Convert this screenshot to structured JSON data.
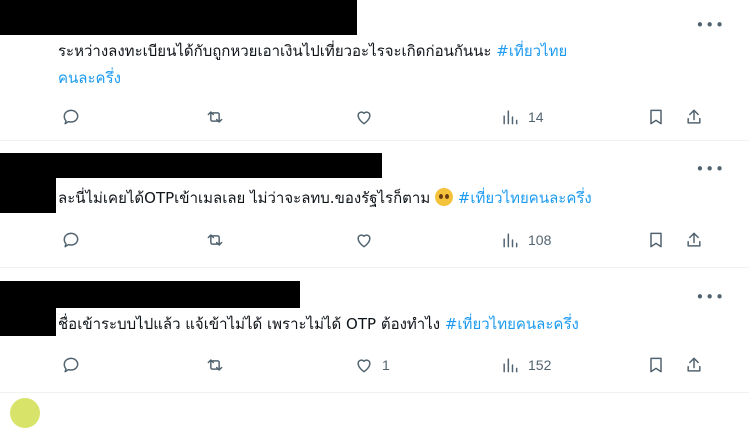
{
  "tweets": [
    {
      "text": "ระหว่างลงทะเบียนได้กับถูกหวยเอาเงินไปเที่ยวอะไรจะเกิดก่อนกันนะ ",
      "hashtag_line1": "#เที่ยวไทย",
      "hashtag_line2": "คนละครึ่ง",
      "emoji": "",
      "more": "•••",
      "replies": "",
      "retweets": "",
      "likes": "",
      "views": "14"
    },
    {
      "text": "ละนี่ไม่เคยได้OTPเข้าเมลเลย ไม่ว่าจะลทบ.ของรัฐไรก็ตาม ",
      "emoji": "pleading-face-emoji",
      "hashtag": "#เที่ยวไทยคนละครึ่ง",
      "more": "•••",
      "replies": "",
      "retweets": "",
      "likes": "",
      "views": "108"
    },
    {
      "text": "ชื่อเข้าระบบไปแล้ว แจ้เข้าไม่ได้ เพราะไม่ได้ OTP ต้องทำไง ",
      "hashtag": "#เที่ยวไทยคนละครึ่ง",
      "more": "•••",
      "replies": "",
      "retweets": "",
      "likes": "1",
      "views": "152"
    }
  ],
  "colors": {
    "accent": "#1d9bf0",
    "muted": "#536471",
    "divider": "#eff3f4"
  },
  "icons": [
    "reply-icon",
    "retweet-icon",
    "like-icon",
    "views-icon",
    "bookmark-icon",
    "share-icon",
    "more-icon"
  ]
}
